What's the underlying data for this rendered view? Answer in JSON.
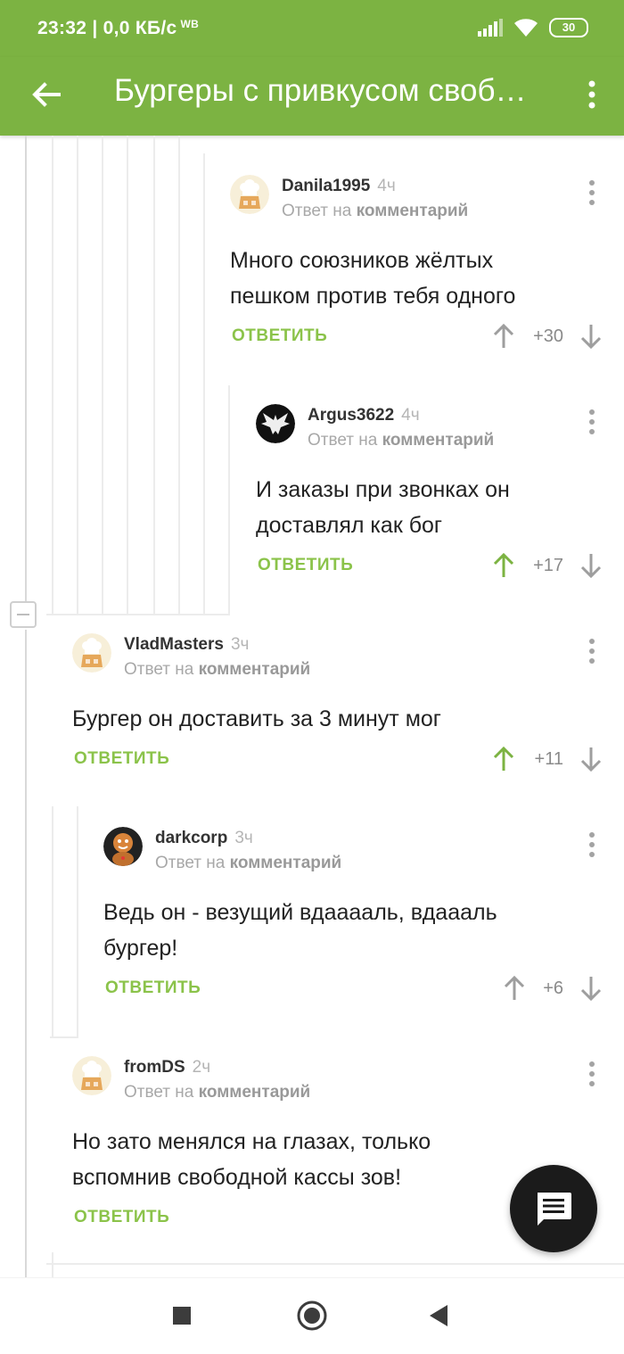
{
  "status_bar": {
    "time_speed": "23:32 | 0,0 КБ/с",
    "carrier_badge": "WB",
    "battery": "30"
  },
  "app_bar": {
    "title": "Бургеры с привкусом своб…",
    "back_icon": "arrow-left-icon",
    "menu_icon": "more-vert-icon"
  },
  "accent_color": "#7cb342",
  "comments": [
    {
      "author": "Danila1995",
      "time": "4ч",
      "reply_prefix": "Ответ на",
      "reply_target": "комментарий",
      "text_lines": [
        "Много союзников жёлтых",
        "пешком против тебя одного"
      ],
      "reply_label": "ОТВЕТИТЬ",
      "rating": "+30",
      "upvoted": false
    },
    {
      "author": "Argus3622",
      "time": "4ч",
      "reply_prefix": "Ответ на",
      "reply_target": "комментарий",
      "text_lines": [
        "И заказы при звонках он",
        "доставлял как бог"
      ],
      "reply_label": "ОТВЕТИТЬ",
      "rating": "+17",
      "upvoted": true
    },
    {
      "author": "VladMasters",
      "time": "3ч",
      "reply_prefix": "Ответ на",
      "reply_target": "комментарий",
      "text_lines": [
        "Бургер он доставить за 3 минут мог"
      ],
      "reply_label": "ОТВЕТИТЬ",
      "rating": "+11",
      "upvoted": true
    },
    {
      "author": "darkcorp",
      "time": "3ч",
      "reply_prefix": "Ответ на",
      "reply_target": "комментарий",
      "text_lines": [
        "Ведь он - везущий вдааааль, вдаааль",
        "бургер!"
      ],
      "reply_label": "ОТВЕТИТЬ",
      "rating": "+6",
      "upvoted": false
    },
    {
      "author": "fromDS",
      "time": "2ч",
      "reply_prefix": "Ответ на",
      "reply_target": "комментарий",
      "text_lines": [
        "Но зато менялся на глазах, только",
        "вспомнив свободной кассы зов!"
      ],
      "reply_label": "ОТВЕТИТЬ"
    }
  ],
  "fab_icon": "comment-icon",
  "nav": {
    "recents_icon": "square-icon",
    "home_icon": "circle-icon",
    "back_icon": "triangle-back-icon"
  }
}
